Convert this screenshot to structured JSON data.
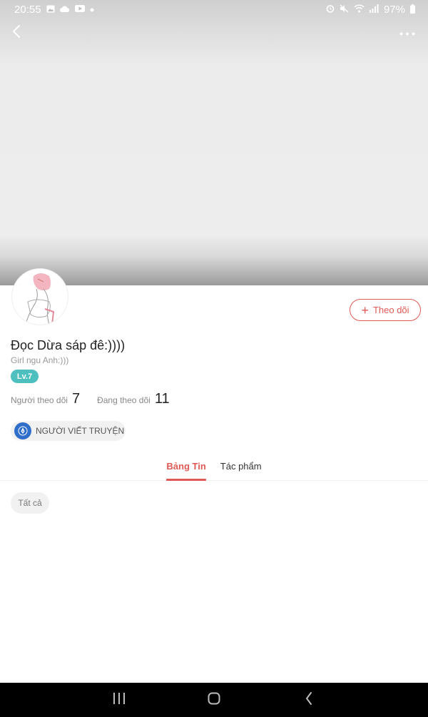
{
  "status_bar": {
    "time": "20:55",
    "battery": "97%",
    "left_icons": [
      "gallery-icon",
      "cloud-icon",
      "youtube-icon",
      "dot-icon"
    ],
    "right_icons": [
      "alarm-icon",
      "mute-icon",
      "wifi-icon",
      "signal-icon",
      "battery-icon"
    ]
  },
  "top_nav": {
    "back_icon": "chevron-left-icon",
    "more_icon": "more-dots-icon"
  },
  "profile": {
    "name": "Đọc Dừa sáp đê:))))",
    "bio": "Girl ngu Anh:)))",
    "level": "Lv.7",
    "follow_label": "Theo dõi",
    "followers_label": "Người theo dõi",
    "followers_count": "7",
    "following_label": "Đang theo dõi",
    "following_count": "11",
    "role": "NGƯỜI VIẾT TRUYỆN"
  },
  "tabs": [
    {
      "label": "Bảng Tin",
      "active": true
    },
    {
      "label": "Tác phẩm",
      "active": false
    }
  ],
  "filter": {
    "label": "Tất cả"
  },
  "colors": {
    "accent": "#e05a55",
    "level": "#4dbfbf",
    "role_icon": "#2f6fc9"
  }
}
